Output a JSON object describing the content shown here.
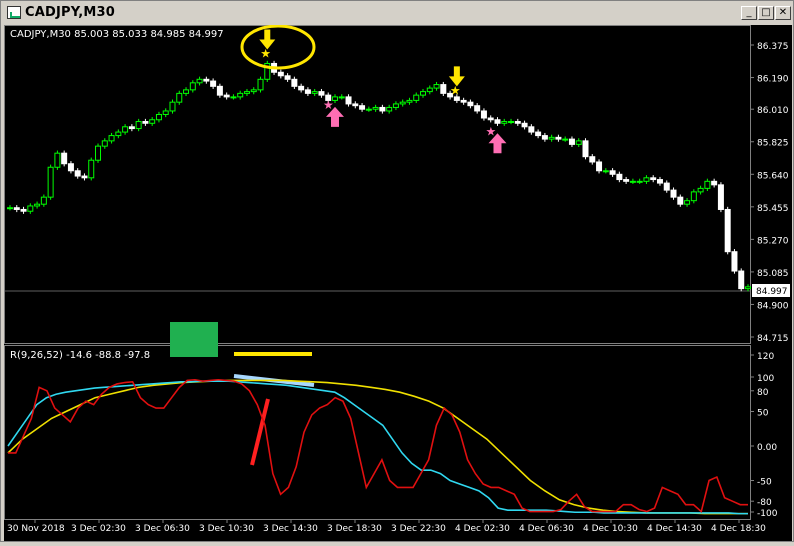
{
  "window": {
    "title": "CADJPY,M30"
  },
  "buttons": {
    "minimize": "_",
    "maximize": "□",
    "close": "✕"
  },
  "chart": {
    "symbol_line": "CADJPY,M30  85.003 85.033 84.985 84.997",
    "current_price": "84.997",
    "price_axis": [
      "86.375",
      "86.190",
      "86.010",
      "85.825",
      "85.640",
      "85.455",
      "85.270",
      "85.085",
      "84.900",
      "84.715"
    ],
    "indicator_line": "R(9,26,52) -14.6 -88.8 -97.8",
    "indicator_axis": [
      "120",
      "100",
      "80",
      "50",
      "0.00",
      "-50",
      "-80",
      "-100"
    ],
    "time_axis": [
      "30 Nov 2018",
      "3 Dec 02:30",
      "3 Dec 06:30",
      "3 Dec 10:30",
      "3 Dec 14:30",
      "3 Dec 18:30",
      "3 Dec 22:30",
      "4 Dec 02:30",
      "4 Dec 06:30",
      "4 Dec 10:30",
      "4 Dec 14:30",
      "4 Dec 18:30"
    ],
    "colors": {
      "up": "#00ff00",
      "down": "#ffffff",
      "rsi_fast": "#e01010",
      "rsi_mid": "#30d8f0",
      "rsi_slow": "#f0e000",
      "sell_arrow": "#ffe600",
      "buy_arrow": "#ff6eb4"
    }
  },
  "chart_data": {
    "type": "candlestick",
    "close": [
      85.45,
      85.44,
      85.43,
      85.46,
      85.47,
      85.51,
      85.68,
      85.76,
      85.7,
      85.66,
      85.63,
      85.62,
      85.72,
      85.8,
      85.83,
      85.86,
      85.88,
      85.91,
      85.9,
      85.94,
      85.93,
      85.95,
      85.98,
      86.0,
      86.05,
      86.1,
      86.12,
      86.16,
      86.18,
      86.17,
      86.14,
      86.09,
      86.08,
      86.08,
      86.1,
      86.11,
      86.12,
      86.18,
      86.27,
      86.22,
      86.2,
      86.18,
      86.14,
      86.12,
      86.1,
      86.11,
      86.09,
      86.06,
      86.08,
      86.08,
      86.04,
      86.03,
      86.01,
      86.01,
      86.02,
      86.0,
      86.02,
      86.04,
      86.05,
      86.06,
      86.09,
      86.11,
      86.13,
      86.15,
      86.1,
      86.08,
      86.06,
      86.05,
      86.03,
      86.0,
      85.96,
      85.95,
      85.93,
      85.94,
      85.94,
      85.93,
      85.91,
      85.88,
      85.86,
      85.84,
      85.85,
      85.84,
      85.84,
      85.81,
      85.83,
      85.74,
      85.71,
      85.66,
      85.66,
      85.64,
      85.61,
      85.6,
      85.6,
      85.6,
      85.62,
      85.61,
      85.59,
      85.55,
      85.51,
      85.47,
      85.49,
      85.54,
      85.56,
      85.6,
      85.58,
      85.44,
      85.2,
      85.09,
      84.99,
      85.0
    ],
    "rsi_fast": [
      -10,
      -10,
      15,
      40,
      85,
      80,
      55,
      45,
      35,
      55,
      65,
      60,
      75,
      85,
      90,
      92,
      93,
      70,
      60,
      55,
      55,
      70,
      85,
      95,
      96,
      94,
      95,
      96,
      95,
      94,
      90,
      80,
      60,
      30,
      -40,
      -70,
      -60,
      -30,
      20,
      45,
      55,
      60,
      70,
      65,
      40,
      -10,
      -60,
      -40,
      -20,
      -50,
      -60,
      -60,
      -60,
      -40,
      -20,
      30,
      55,
      45,
      20,
      -20,
      -40,
      -55,
      -60,
      -60,
      -65,
      -70,
      -90,
      -95,
      -95,
      -95,
      -95,
      -92,
      -80,
      -70,
      -88,
      -95,
      -95,
      -95,
      -95,
      -85,
      -85,
      -92,
      -95,
      -90,
      -60,
      -65,
      -70,
      -85,
      -85,
      -95,
      -50,
      -45,
      -75,
      -80,
      -85,
      -85
    ],
    "rsi_mid": [
      0,
      20,
      40,
      60,
      70,
      75,
      78,
      80,
      82,
      84,
      85,
      86,
      87,
      88,
      89,
      90,
      91,
      92,
      93,
      93,
      94,
      94,
      94,
      94,
      93,
      92,
      91,
      90,
      89,
      88,
      86,
      84,
      82,
      80,
      78,
      70,
      60,
      50,
      40,
      30,
      10,
      -10,
      -25,
      -35,
      -35,
      -40,
      -50,
      -55,
      -60,
      -65,
      -75,
      -90,
      -93,
      -93,
      -93,
      -93,
      -93,
      -94,
      -95,
      -96,
      -96,
      -96,
      -97,
      -97,
      -97,
      -97,
      -97,
      -97,
      -97,
      -97,
      -97,
      -97,
      -97,
      -97,
      -97,
      -97,
      -98,
      -98
    ],
    "rsi_slow": [
      -10,
      10,
      25,
      40,
      50,
      60,
      70,
      75,
      80,
      85,
      88,
      90,
      92,
      93,
      94,
      95,
      95,
      95,
      95,
      95,
      94,
      93,
      92,
      90,
      88,
      85,
      82,
      78,
      72,
      65,
      55,
      40,
      25,
      10,
      -10,
      -30,
      -50,
      -65,
      -78,
      -85,
      -90,
      -93,
      -95,
      -96,
      -97,
      -97,
      -97,
      -97,
      -98,
      -98,
      -98,
      -98
    ],
    "sell_signals": [
      38,
      66
    ],
    "buy_signals": [
      48,
      72
    ],
    "ylim": [
      84.715,
      86.375
    ],
    "indicator_ylim": [
      -100,
      120
    ]
  }
}
